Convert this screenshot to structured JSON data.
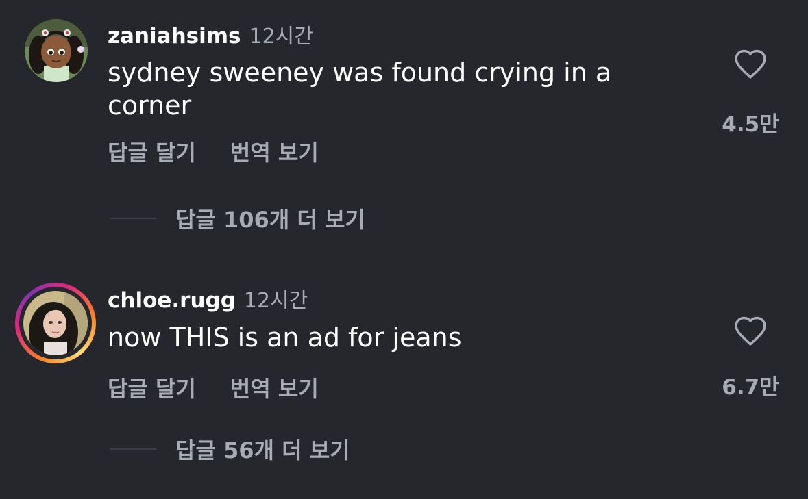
{
  "comments": [
    {
      "username": "zaniahsims",
      "time": "12시간",
      "text": "sydney sweeney was found crying in a corner",
      "reply_label": "답글 달기",
      "translate_label": "번역 보기",
      "view_replies_label": "답글 106개 더 보기",
      "like_count": "4.5만"
    },
    {
      "username": "chloe.rugg",
      "time": "12시간",
      "text": "now THIS is an ad for jeans",
      "reply_label": "답글 달기",
      "translate_label": "번역 보기",
      "view_replies_label": "답글 56개 더 보기",
      "like_count": "6.7만"
    }
  ],
  "colors": {
    "background": "#25272c",
    "text_primary": "#ffffff",
    "text_secondary": "#a8abb3"
  }
}
